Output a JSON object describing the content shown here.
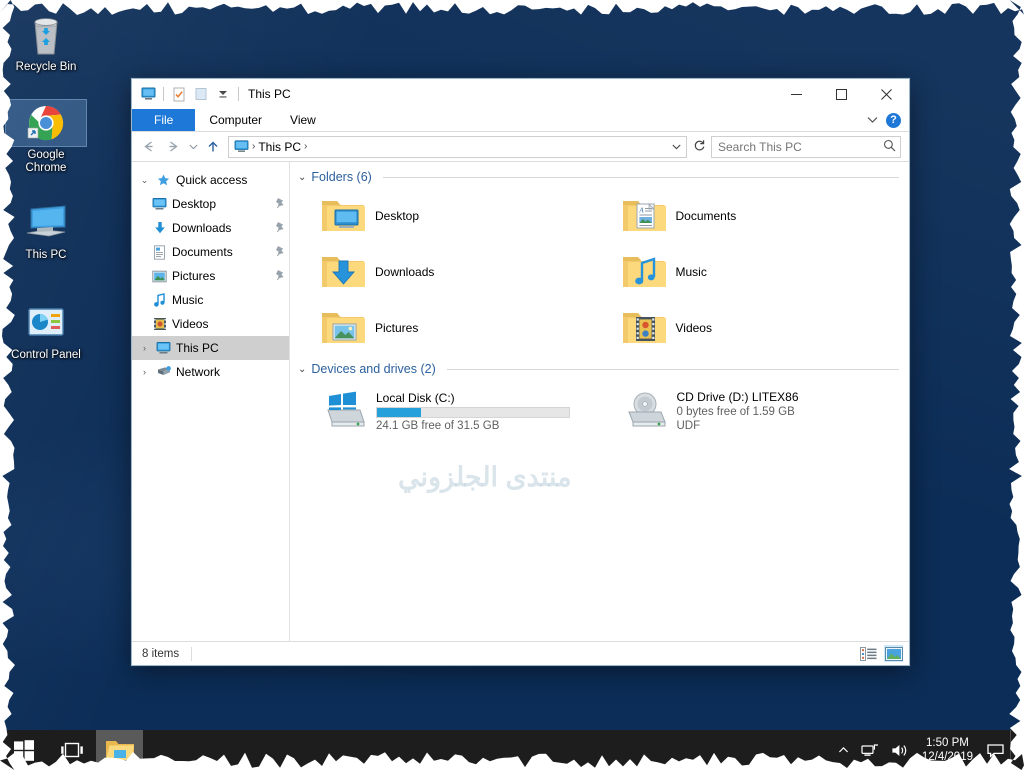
{
  "desktop": {
    "icons": [
      {
        "name": "Recycle Bin",
        "icon": "recycle-bin-icon",
        "selected": false
      },
      {
        "name": "Google Chrome",
        "icon": "chrome-icon",
        "selected": true
      },
      {
        "name": "This PC",
        "icon": "this-pc-icon",
        "selected": false
      },
      {
        "name": "Control Panel",
        "icon": "control-panel-icon",
        "selected": false
      }
    ],
    "wallpaper_color": "#0c2d57"
  },
  "window": {
    "title": "This PC",
    "quick_access": [
      {
        "name": "this-pc-icon",
        "label": "This PC"
      },
      {
        "name": "properties-icon",
        "label": "Properties"
      },
      {
        "name": "new-folder-icon",
        "label": "New folder"
      },
      {
        "name": "customize-dropdown-icon",
        "label": "Customize Quick Access Toolbar"
      }
    ],
    "controls": {
      "minimize": "—",
      "maximize": "☐",
      "close": "✕"
    },
    "ribbon": {
      "tabs": [
        {
          "label": "File",
          "active": true
        },
        {
          "label": "Computer",
          "active": false
        },
        {
          "label": "View",
          "active": false
        }
      ],
      "expand_icon": "chevron-down-icon",
      "help_label": "?"
    },
    "address": {
      "back_icon": "arrow-left-icon",
      "forward_icon": "arrow-right-icon",
      "recent_icon": "chevron-down-icon",
      "up_icon": "arrow-up-icon",
      "crumb_root_icon": "this-pc-icon",
      "crumbs": [
        "This PC"
      ],
      "dropdown_icon": "chevron-down-icon",
      "refresh_icon": "refresh-icon"
    },
    "search": {
      "placeholder": "Search This PC",
      "icon": "search-icon"
    },
    "nav_pane": [
      {
        "label": "Quick access",
        "icon": "star-pin-icon",
        "chevron": "⌄",
        "indent": 0,
        "pinned": false,
        "selected": false
      },
      {
        "label": "Desktop",
        "icon": "desktop-icon",
        "chevron": "",
        "indent": 1,
        "pinned": true,
        "selected": false
      },
      {
        "label": "Downloads",
        "icon": "downloads-icon",
        "chevron": "",
        "indent": 1,
        "pinned": true,
        "selected": false
      },
      {
        "label": "Documents",
        "icon": "documents-icon",
        "chevron": "",
        "indent": 1,
        "pinned": true,
        "selected": false
      },
      {
        "label": "Pictures",
        "icon": "pictures-icon",
        "chevron": "",
        "indent": 1,
        "pinned": true,
        "selected": false
      },
      {
        "label": "Music",
        "icon": "music-icon",
        "chevron": "",
        "indent": 1,
        "pinned": false,
        "selected": false
      },
      {
        "label": "Videos",
        "icon": "videos-icon",
        "chevron": "",
        "indent": 1,
        "pinned": false,
        "selected": false
      },
      {
        "label": "This PC",
        "icon": "this-pc-icon",
        "chevron": "›",
        "indent": 0,
        "pinned": false,
        "selected": true
      },
      {
        "label": "Network",
        "icon": "network-icon",
        "chevron": "›",
        "indent": 0,
        "pinned": false,
        "selected": false
      }
    ],
    "groups": {
      "folders": {
        "title": "Folders (6)",
        "chevron": "⌄",
        "items": [
          {
            "label": "Desktop",
            "icon": "folder-desktop-icon"
          },
          {
            "label": "Documents",
            "icon": "folder-documents-icon"
          },
          {
            "label": "Downloads",
            "icon": "folder-downloads-icon"
          },
          {
            "label": "Music",
            "icon": "folder-music-icon"
          },
          {
            "label": "Pictures",
            "icon": "folder-pictures-icon"
          },
          {
            "label": "Videos",
            "icon": "folder-videos-icon"
          }
        ]
      },
      "devices": {
        "title": "Devices and drives (2)",
        "chevron": "⌄",
        "items": [
          {
            "label": "Local Disk (C:)",
            "icon": "hard-drive-windows-icon",
            "has_meter": true,
            "used_percent": 23,
            "sub1": "24.1 GB free of 31.5 GB",
            "sub2": "",
            "bar_color": "#26a0da"
          },
          {
            "label": "CD Drive (D:) LITEX86",
            "icon": "cd-drive-icon",
            "has_meter": false,
            "used_percent": 0,
            "sub1": "0 bytes free of 1.59 GB",
            "sub2": "UDF",
            "bar_color": "#26a0da"
          }
        ]
      }
    },
    "watermark": "منتدى الجلزوني",
    "status": {
      "item_count": "8 items",
      "view_details_icon": "details-view-icon",
      "view_large_icon": "large-icons-view-icon"
    }
  },
  "taskbar": {
    "start_icon": "windows-start-icon",
    "task_view_icon": "task-view-icon",
    "apps": [
      {
        "name": "file-explorer-icon",
        "label": "File Explorer",
        "active": true
      }
    ],
    "tray": {
      "overflow_icon": "chevron-up-icon",
      "network_icon": "network-tray-icon",
      "volume_icon": "volume-icon",
      "time": "1:50 PM",
      "date": "12/4/2019",
      "action_center_icon": "action-center-icon"
    }
  }
}
